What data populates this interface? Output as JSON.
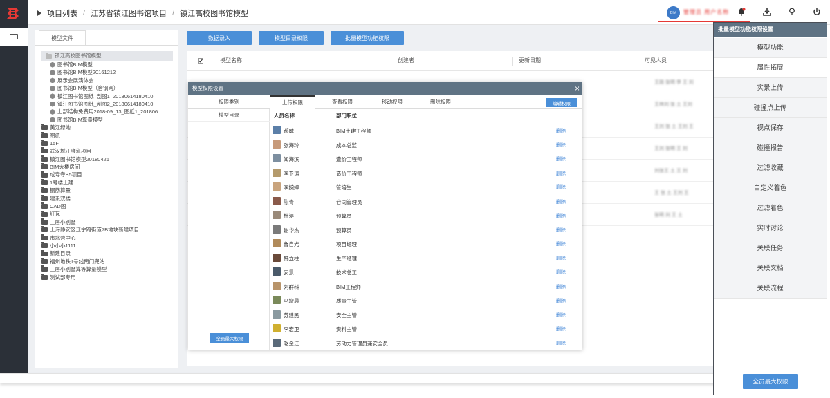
{
  "breadcrumb": [
    "项目列表",
    "江苏省镇江图书馆项目",
    "镇江高校图书馆模型"
  ],
  "breadcrumb_separator": "/",
  "user": {
    "avatar_text": "BIM",
    "name": "管理员 用户名称"
  },
  "top_icons": [
    "bell-icon",
    "download-icon",
    "lightbulb-icon",
    "power-icon"
  ],
  "tree": {
    "tab_label": "模型文件",
    "root": "镇江高校图书馆模型",
    "children": [
      "图书馆BIM模型",
      "图书馆BIM模型20161212",
      "展示会展演体会",
      "图书馆BIM模型（含钢网）",
      "镇江图书馆图纸_剖图1_20180614180410",
      "镇江图书馆图纸_剖图2_20180614180410",
      "上部结构免费用2018-09_13_图纸1_201806...",
      "图书馆BIM算量模型"
    ],
    "folders": [
      "美江绿地",
      "图纸",
      "15F",
      "武汉城江隧道项目",
      "镇江图书馆模型20180426",
      "BIM大楼房间",
      "成寿寺B5项目",
      "1号楼土建",
      "钢筋算量",
      "建设双楼",
      "CAD图",
      "红瓦",
      "三层小别墅",
      "上海静安区江宁路街道7B地块新建项目",
      "市北营中心",
      "小小小1111",
      "新建目录",
      "福州地铁1号线南门兜站",
      "三层小别墅算等算量模型",
      "测试部专用"
    ]
  },
  "actions": {
    "data_entry": "数据录入",
    "dir_permission": "模型目录权限",
    "batch_permission": "批量模型功能权限"
  },
  "table": {
    "headers": [
      "模型名称",
      "创建者",
      "更新日期",
      "可见人员"
    ],
    "blurred_cells": [
      "王刚 张明 李 王 刘",
      "王林刘 张 土 王刘",
      "王刘 张 土 王刘 王",
      "王刘 张明 王 刘",
      "刘张王 土 王 刘",
      "王 张 土 王刘 王",
      "张明 刘 王 土"
    ]
  },
  "modal": {
    "title": "模型权限设置",
    "tabs": [
      "权限类别",
      "上传权限",
      "查看权限",
      "移动权限",
      "删除权限"
    ],
    "active_tab": 1,
    "edit_button": "编辑权限",
    "left_item": "模型目录",
    "left_button": "全员最大权限",
    "col_person": "人员名称",
    "col_dept": "部门职位",
    "delete_label": "删除",
    "people": [
      {
        "name": "郝威",
        "dept": "BIM土建工程师",
        "color": "#5b7fa8"
      },
      {
        "name": "张海玲",
        "dept": "成本总监",
        "color": "#c79a7a"
      },
      {
        "name": "闻海滨",
        "dept": "造价工程师",
        "color": "#7d8fa0"
      },
      {
        "name": "李卫涛",
        "dept": "造价工程师",
        "color": "#b49a6c"
      },
      {
        "name": "李婉婷",
        "dept": "管培生",
        "color": "#c9a47d"
      },
      {
        "name": "陈青",
        "dept": "合同管理员",
        "color": "#8a5a4a"
      },
      {
        "name": "杜浔",
        "dept": "预算员",
        "color": "#9a8a7a"
      },
      {
        "name": "谢华杰",
        "dept": "预算员",
        "color": "#7a7a7a"
      },
      {
        "name": "鲁自光",
        "dept": "项目经理",
        "color": "#b08a5a"
      },
      {
        "name": "韩立柱",
        "dept": "生产经理",
        "color": "#6a4a3a"
      },
      {
        "name": "安景",
        "dept": "技术总工",
        "color": "#4a5a6a"
      },
      {
        "name": "刘群科",
        "dept": "BIM工程师",
        "color": "#b8946a"
      },
      {
        "name": "马增晨",
        "dept": "质量主管",
        "color": "#7a8a5a"
      },
      {
        "name": "苏建民",
        "dept": "安全主管",
        "color": "#8a9aa0"
      },
      {
        "name": "李宏卫",
        "dept": "资料主管",
        "color": "#d0b030"
      },
      {
        "name": "赵金江",
        "dept": "劳动力管理员兼安全员",
        "color": "#5a6a7a"
      }
    ]
  },
  "side_panel": {
    "title": "批量模型功能权限设置",
    "items": [
      "模型功能",
      "属性拓展",
      "实景上传",
      "碰撞点上传",
      "视点保存",
      "碰撞报告",
      "过滤收藏",
      "自定义着色",
      "过滤着色",
      "实时讨论",
      "关联任务",
      "关联文档",
      "关联流程"
    ],
    "selected_index": 1,
    "button": "全员最大权限"
  }
}
